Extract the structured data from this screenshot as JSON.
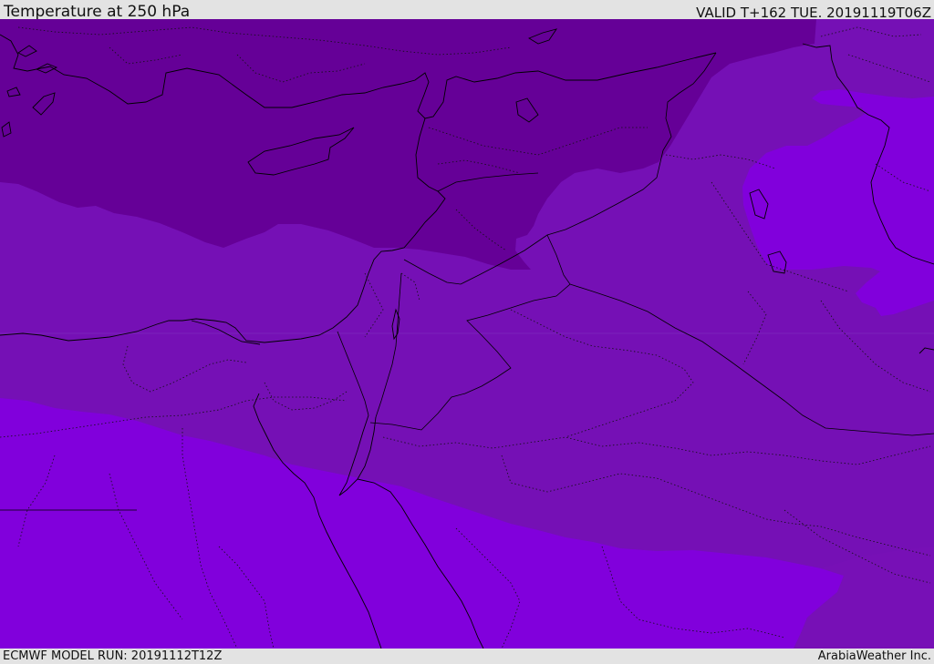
{
  "header": {
    "title": "Temperature at 250 hPa",
    "valid_time": "VALID T+162 TUE. 20191119T06Z"
  },
  "footer": {
    "model_run": "ECMWF MODEL RUN: 20191112T12Z",
    "credit": "ArabiaWeather Inc."
  },
  "colors": {
    "band_coldest": "#650097",
    "band_mid": "#7510b5",
    "band_warm": "#8100dc",
    "band_east_mid": "#7a12b8",
    "coastline": "#000000",
    "frame_background": "#e3e3e3"
  }
}
